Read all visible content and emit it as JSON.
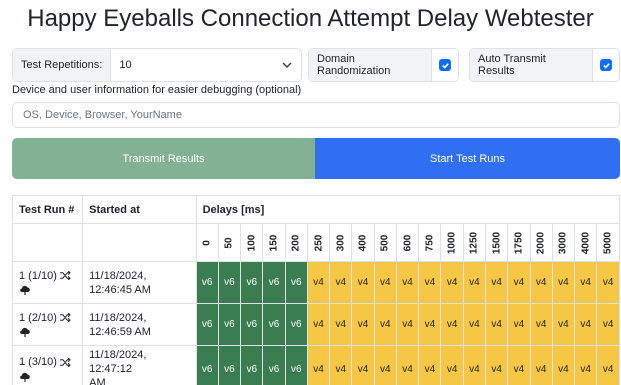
{
  "title": "Happy Eyeballs Connection Attempt Delay Webtester",
  "controls": {
    "repetitions_label": "Test Repetitions:",
    "repetitions_value": "10",
    "domain_randomization_label": "Domain Randomization",
    "domain_randomization_checked": true,
    "auto_transmit_label": "Auto Transmit Results",
    "auto_transmit_checked": true
  },
  "device_info": {
    "label": "Device and user information for easier debugging (optional)",
    "placeholder": "OS, Device, Browser, YourName"
  },
  "buttons": {
    "transmit": "Transmit Results",
    "start": "Start Test Runs"
  },
  "table": {
    "headers": {
      "run": "Test Run #",
      "started": "Started at",
      "delays": "Delays [ms]"
    },
    "delays": [
      "0",
      "50",
      "100",
      "150",
      "200",
      "250",
      "300",
      "400",
      "500",
      "600",
      "750",
      "1000",
      "1250",
      "1500",
      "1750",
      "2000",
      "3000",
      "4000",
      "5000"
    ],
    "rows": [
      {
        "run": "1 (1/10)",
        "started_line1": "11/18/2024,",
        "started_line2": "12:46:45 AM",
        "results": [
          "v6",
          "v6",
          "v6",
          "v6",
          "v6",
          "v4",
          "v4",
          "v4",
          "v4",
          "v4",
          "v4",
          "v4",
          "v4",
          "v4",
          "v4",
          "v4",
          "v4",
          "v4",
          "v4"
        ]
      },
      {
        "run": "1 (2/10)",
        "started_line1": "11/18/2024,",
        "started_line2": "12:46:59 AM",
        "results": [
          "v6",
          "v6",
          "v6",
          "v6",
          "v6",
          "v4",
          "v4",
          "v4",
          "v4",
          "v4",
          "v4",
          "v4",
          "v4",
          "v4",
          "v4",
          "v4",
          "v4",
          "v4",
          "v4"
        ]
      },
      {
        "run": "1 (3/10)",
        "started_line1": "11/18/2024, 12:47:12",
        "started_line2": "AM",
        "results": [
          "v6",
          "v6",
          "v6",
          "v6",
          "v6",
          "v4",
          "v4",
          "v4",
          "v4",
          "v4",
          "v4",
          "v4",
          "v4",
          "v4",
          "v4",
          "v4",
          "v4",
          "v4",
          "v4"
        ]
      }
    ]
  },
  "colors": {
    "v6": "#3a7d50",
    "v4": "#f6c645",
    "transmit_button": "#82b293",
    "start_button": "#306ff1",
    "checkbox": "#0d6efd"
  }
}
